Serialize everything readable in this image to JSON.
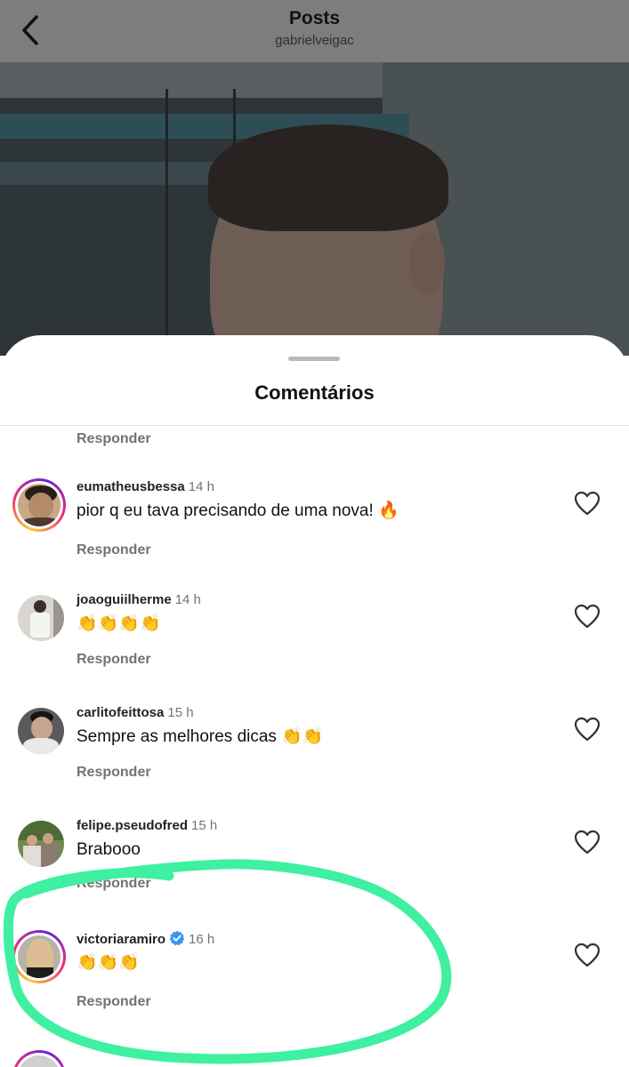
{
  "header": {
    "title": "Posts",
    "username": "gabrielveigac",
    "back_icon": "chevron-left-icon"
  },
  "sheet": {
    "title": "Comentários",
    "top_reply": "Responder"
  },
  "comments": [
    {
      "username": "eumatheusbessa",
      "time": "14 h",
      "text": "pior q eu tava precisando de uma nova! 🔥",
      "reply": "Responder",
      "verified": false,
      "story_ring": true
    },
    {
      "username": "joaoguiilherme",
      "time": "14 h",
      "text": "👏👏👏👏",
      "reply": "Responder",
      "verified": false,
      "story_ring": false
    },
    {
      "username": "carlitofeittosa",
      "time": "15 h",
      "text": "Sempre as melhores dicas 👏👏",
      "reply": "Responder",
      "verified": false,
      "story_ring": false
    },
    {
      "username": "felipe.pseudofred",
      "time": "15 h",
      "text": "Brabooo",
      "reply": "Responder",
      "verified": false,
      "story_ring": false
    },
    {
      "username": "victoriaramiro",
      "time": "16 h",
      "text": "👏👏👏",
      "reply": "Responder",
      "verified": true,
      "story_ring": true
    }
  ],
  "colors": {
    "highlight": "#3ff0a0",
    "verified": "#3797f0",
    "secondary_text": "#737373"
  }
}
